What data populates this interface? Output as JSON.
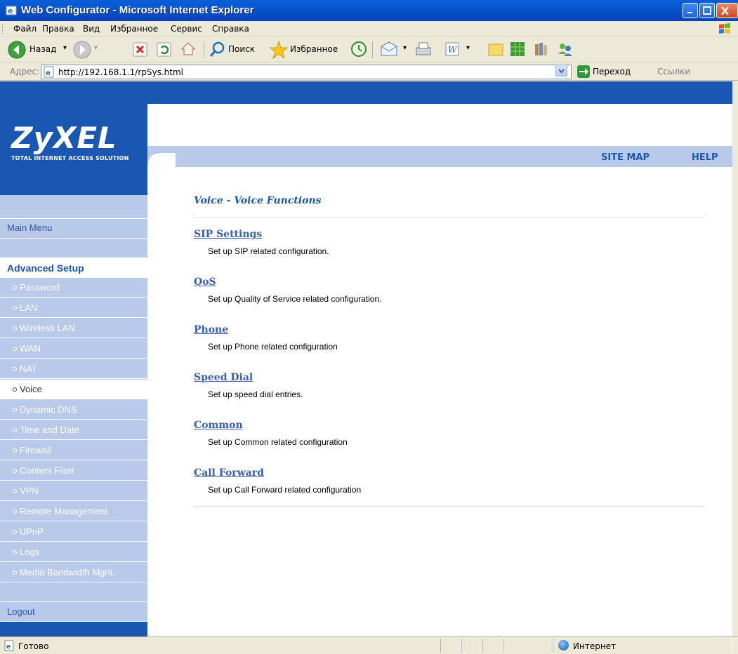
{
  "window": {
    "title": "Web Configurator - Microsoft Internet Explorer"
  },
  "menu": [
    "Файл",
    "Правка",
    "Вид",
    "Избранное",
    "Сервис",
    "Справка"
  ],
  "toolbar": {
    "back_label": "Назад",
    "search_label": "Поиск",
    "favorites_label": "Избранное"
  },
  "address": {
    "label": "Адрес:",
    "url": "http://192.168.1.1/rpSys.html",
    "go_label": "Переход",
    "links_label": "Ссылки"
  },
  "header": {
    "logo": "ZyXEL",
    "logo_tagline": "TOTAL INTERNET ACCESS SOLUTION",
    "site_map": "SITE MAP",
    "help": "HELP"
  },
  "sidebar": {
    "main_menu": "Main Menu",
    "advanced_setup": "Advanced Setup",
    "items": [
      {
        "label": "Password",
        "active": false
      },
      {
        "label": "LAN",
        "active": false
      },
      {
        "label": "Wireless LAN",
        "active": false
      },
      {
        "label": "WAN",
        "active": false
      },
      {
        "label": "NAT",
        "active": false
      },
      {
        "label": "Voice",
        "active": true
      },
      {
        "label": "Dynamic DNS",
        "active": false
      },
      {
        "label": "Time and Date",
        "active": false
      },
      {
        "label": "Firewall",
        "active": false
      },
      {
        "label": "Content Filter",
        "active": false
      },
      {
        "label": "VPN",
        "active": false
      },
      {
        "label": "Remote Management",
        "active": false
      },
      {
        "label": "UPnP",
        "active": false
      },
      {
        "label": "Logs",
        "active": false
      },
      {
        "label": "Media Bandwidth Mgnt.",
        "active": false
      }
    ],
    "logout": "Logout"
  },
  "content": {
    "title": "Voice - Voice Functions",
    "sections": [
      {
        "link": "SIP Settings",
        "desc": "Set up SIP related configuration."
      },
      {
        "link": "QoS",
        "desc": "Set up Quality of Service related configuration."
      },
      {
        "link": "Phone",
        "desc": "Set up Phone related configuration"
      },
      {
        "link": "Speed Dial",
        "desc": "Set up speed dial entries."
      },
      {
        "link": "Common",
        "desc": "Set up Common related configuration"
      },
      {
        "link": "Call Forward",
        "desc": "Set up Call Forward related configuration"
      }
    ]
  },
  "status": {
    "text": "Готово",
    "zone": "Интернет"
  },
  "colors": {
    "brand_blue": "#1a57b3",
    "sidebar_bg": "#b8c9ea",
    "link": "#3a5fb0"
  }
}
